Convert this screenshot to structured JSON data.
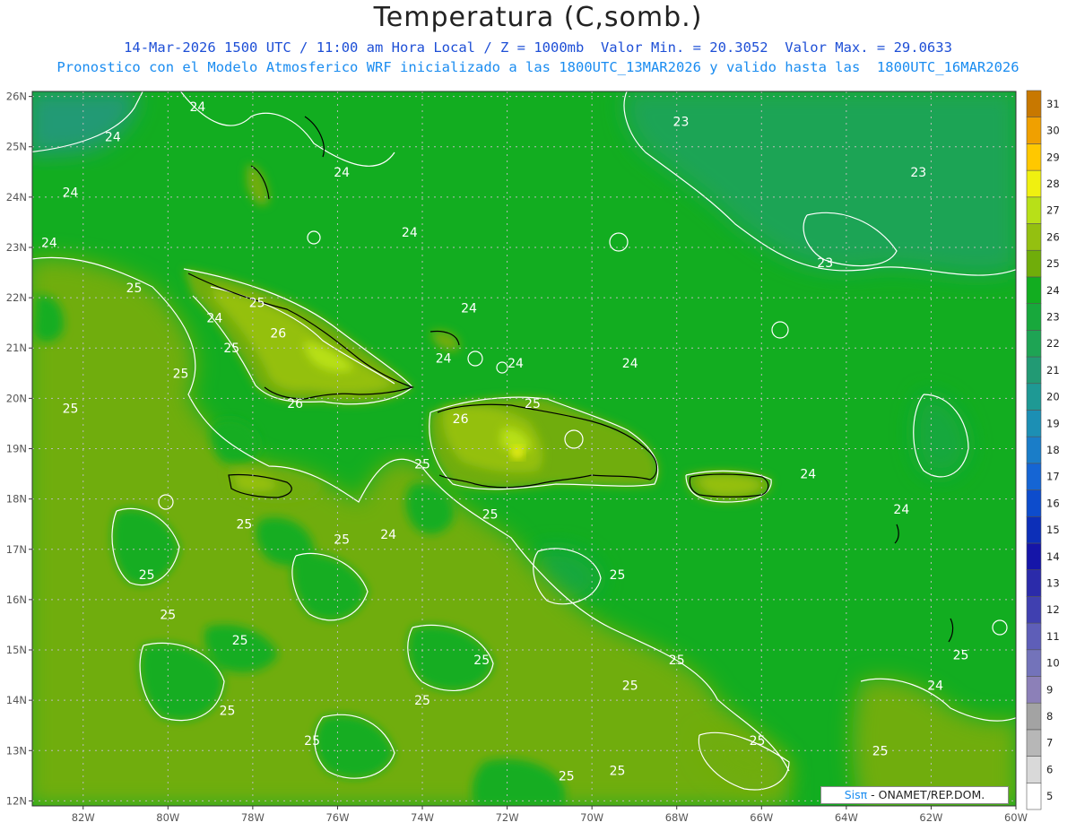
{
  "header": {
    "title": "Temperatura (C,somb.)",
    "subtitle_line1": "14-Mar-2026 1500 UTC / 11:00 am Hora Local / Z = 1000mb  Valor Min. = 20.3052  Valor Max. = 29.0633",
    "subtitle_line2": "Pronostico con el Modelo Atmosferico WRF inicializado a las 1800UTC_13MAR2026 y valido hasta las  1800UTC_16MAR2026"
  },
  "map": {
    "lon_range": [
      -83.2,
      -60
    ],
    "lat_range": [
      11.9,
      26.1
    ],
    "lon_tick_labels": [
      "82W",
      "80W",
      "78W",
      "76W",
      "74W",
      "72W",
      "70W",
      "68W",
      "66W",
      "64W",
      "62W",
      "60W"
    ],
    "lon_tick_values": [
      -82,
      -80,
      -78,
      -76,
      -74,
      -72,
      -70,
      -68,
      -66,
      -64,
      -62,
      -60
    ],
    "lat_tick_labels": [
      "12N",
      "13N",
      "14N",
      "15N",
      "16N",
      "17N",
      "18N",
      "19N",
      "20N",
      "21N",
      "22N",
      "23N",
      "24N",
      "25N",
      "26N"
    ],
    "lat_tick_values": [
      12,
      13,
      14,
      15,
      16,
      17,
      18,
      19,
      20,
      21,
      22,
      23,
      24,
      25,
      26
    ],
    "contour_labels": [
      {
        "text": "24",
        "lon": -79.3,
        "lat": 25.8
      },
      {
        "text": "24",
        "lon": -81.3,
        "lat": 25.2
      },
      {
        "text": "24",
        "lon": -82.3,
        "lat": 24.1
      },
      {
        "text": "24",
        "lon": -75.9,
        "lat": 24.5
      },
      {
        "text": "24",
        "lon": -82.8,
        "lat": 23.1
      },
      {
        "text": "24",
        "lon": -74.3,
        "lat": 23.3
      },
      {
        "text": "25",
        "lon": -80.8,
        "lat": 22.2
      },
      {
        "text": "25",
        "lon": -77.9,
        "lat": 21.9
      },
      {
        "text": "24",
        "lon": -78.9,
        "lat": 21.6
      },
      {
        "text": "26",
        "lon": -77.4,
        "lat": 21.3
      },
      {
        "text": "25",
        "lon": -78.5,
        "lat": 21.0
      },
      {
        "text": "24",
        "lon": -72.9,
        "lat": 21.8
      },
      {
        "text": "24",
        "lon": -73.5,
        "lat": 20.8
      },
      {
        "text": "24",
        "lon": -71.8,
        "lat": 20.7
      },
      {
        "text": "24",
        "lon": -69.1,
        "lat": 20.7
      },
      {
        "text": "25",
        "lon": -79.7,
        "lat": 20.5
      },
      {
        "text": "25",
        "lon": -82.3,
        "lat": 19.8
      },
      {
        "text": "26",
        "lon": -77.0,
        "lat": 19.9
      },
      {
        "text": "26",
        "lon": -73.1,
        "lat": 19.6
      },
      {
        "text": "25",
        "lon": -71.4,
        "lat": 19.9
      },
      {
        "text": "25",
        "lon": -74.0,
        "lat": 18.7
      },
      {
        "text": "24",
        "lon": -64.9,
        "lat": 18.5
      },
      {
        "text": "24",
        "lon": -62.7,
        "lat": 17.8
      },
      {
        "text": "25",
        "lon": -72.4,
        "lat": 17.7
      },
      {
        "text": "25",
        "lon": -78.2,
        "lat": 17.5
      },
      {
        "text": "25",
        "lon": -75.9,
        "lat": 17.2
      },
      {
        "text": "24",
        "lon": -74.8,
        "lat": 17.3
      },
      {
        "text": "25",
        "lon": -80.5,
        "lat": 16.5
      },
      {
        "text": "25",
        "lon": -69.4,
        "lat": 16.5
      },
      {
        "text": "25",
        "lon": -80.0,
        "lat": 15.7
      },
      {
        "text": "25",
        "lon": -78.3,
        "lat": 15.2
      },
      {
        "text": "25",
        "lon": -72.6,
        "lat": 14.8
      },
      {
        "text": "25",
        "lon": -68.0,
        "lat": 14.8
      },
      {
        "text": "25",
        "lon": -69.1,
        "lat": 14.3
      },
      {
        "text": "24",
        "lon": -61.9,
        "lat": 14.3
      },
      {
        "text": "25",
        "lon": -61.3,
        "lat": 14.9
      },
      {
        "text": "25",
        "lon": -74.0,
        "lat": 14.0
      },
      {
        "text": "25",
        "lon": -78.6,
        "lat": 13.8
      },
      {
        "text": "25",
        "lon": -76.6,
        "lat": 13.2
      },
      {
        "text": "25",
        "lon": -66.1,
        "lat": 13.2
      },
      {
        "text": "25",
        "lon": -63.2,
        "lat": 13.0
      },
      {
        "text": "25",
        "lon": -69.4,
        "lat": 12.6
      },
      {
        "text": "25",
        "lon": -70.6,
        "lat": 12.5
      },
      {
        "text": "23",
        "lon": -67.9,
        "lat": 25.5
      },
      {
        "text": "23",
        "lon": -62.3,
        "lat": 24.5
      },
      {
        "text": "23",
        "lon": -64.5,
        "lat": 22.7
      }
    ]
  },
  "colorbar": {
    "labels": [
      "5",
      "6",
      "7",
      "8",
      "9",
      "10",
      "11",
      "12",
      "13",
      "14",
      "15",
      "16",
      "17",
      "18",
      "19",
      "20",
      "21",
      "22",
      "23",
      "24",
      "25",
      "26",
      "27",
      "28",
      "29",
      "30",
      "31"
    ],
    "colors": [
      "#ffffff",
      "#d9d9d9",
      "#b7b7b7",
      "#a3a3a3",
      "#8c80b8",
      "#7373ba",
      "#5e5eb8",
      "#4040b0",
      "#2b2baa",
      "#1515a8",
      "#0c2fb8",
      "#0d4ccc",
      "#1565d4",
      "#1a7dc8",
      "#1c8fb4",
      "#1e9994",
      "#229a74",
      "#1ea454",
      "#18a83c",
      "#12ad20",
      "#70ad0a",
      "#94c010",
      "#b8e018",
      "#f0f010",
      "#ffc800",
      "#f0a000",
      "#c87800"
    ],
    "bar_fill_colors": [
      "#ffffff",
      "#d9d9d9",
      "#b7b7b7",
      "#a3a3a3",
      "#8c80b8",
      "#7373ba",
      "#5e5eb8",
      "#4040b0",
      "#2b2baa",
      "#1515a8",
      "#0c2fb8",
      "#0d4ccc",
      "#1565d4",
      "#1a7dc8",
      "#1c8fb4",
      "#1e9994",
      "#229a74",
      "#1ea454",
      "#18a83c",
      "#12ad20",
      "#70ad0a",
      "#94c010",
      "#b8e018",
      "#f0f010",
      "#ffc800",
      "#f0a000",
      "#c87800"
    ]
  },
  "footer": {
    "logo": "Sisπ",
    "text": " - ONAMET/REP.DOM."
  }
}
